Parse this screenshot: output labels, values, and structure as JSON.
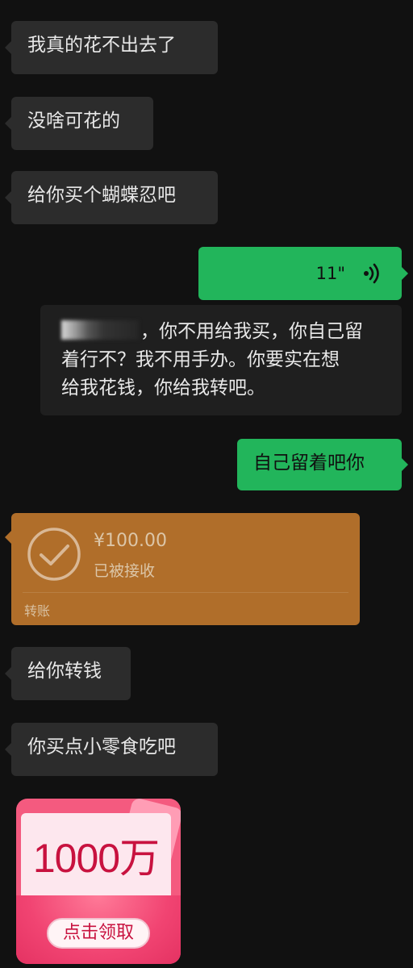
{
  "messages": {
    "m1": "我真的花不出去了",
    "m2": "没啥可花的",
    "m3": "给你买个蝴蝶忍吧",
    "voice": {
      "duration": "11\"",
      "icon": "voice-wave-icon"
    },
    "transcript": {
      "line1": "，你不用给我买，你自己留",
      "line2": "着行不？我不用手办。你要实在想",
      "line3": "给我花钱，你给我转吧。"
    },
    "m5": "自己留着吧你",
    "transfer": {
      "amount": "¥100.00",
      "status": "已被接收",
      "label": "转账",
      "color": "#b06e2a"
    },
    "m6": "给你转钱",
    "m7": "你买点小零食吃吧",
    "red_packet": {
      "amount": "1000万",
      "button": "点击领取"
    }
  },
  "colors": {
    "background": "#111111",
    "incoming_bubble": "#2c2c2c",
    "outgoing_bubble": "#22b55b"
  }
}
